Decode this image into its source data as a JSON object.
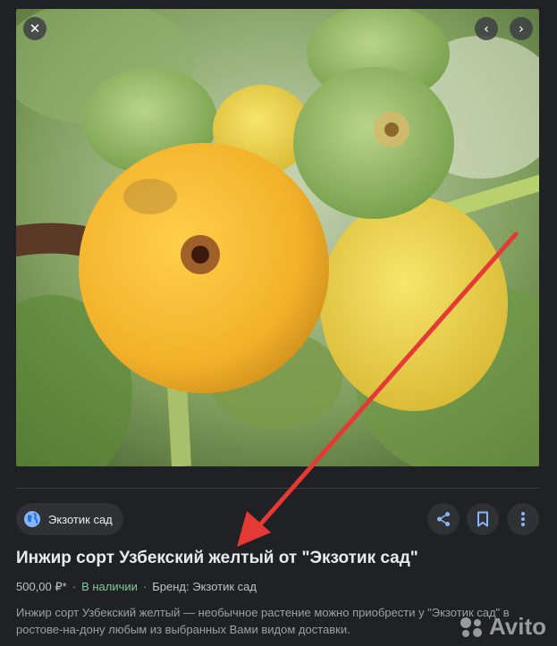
{
  "source": {
    "name": "Экзотик сад",
    "icon": "globe-icon"
  },
  "viewer": {
    "close_icon": "close-icon",
    "prev_icon": "chevron-left-icon",
    "next_icon": "chevron-right-icon",
    "close_glyph": "✕",
    "prev_glyph": "‹",
    "next_glyph": "›"
  },
  "actions": {
    "share_icon": "share-icon",
    "save_icon": "bookmark-icon",
    "more_icon": "more-vert-icon"
  },
  "product": {
    "title": "Инжир сорт Узбекский желтый от \"Экзотик сад\"",
    "price": "500,00 ₽*",
    "stock": "В наличии",
    "brand": "Бренд: Экзотик сад",
    "separator": "·",
    "description": "Инжир сорт Узбекский желтый — необычное растение можно приобрести у \"Экзотик сад\" в ростове-на-дону любым из выбранных Вами видом доставки."
  },
  "watermark": {
    "text": "Avito"
  },
  "colors": {
    "background": "#202124",
    "stock": "#81c995",
    "arrow": "#e53935"
  }
}
